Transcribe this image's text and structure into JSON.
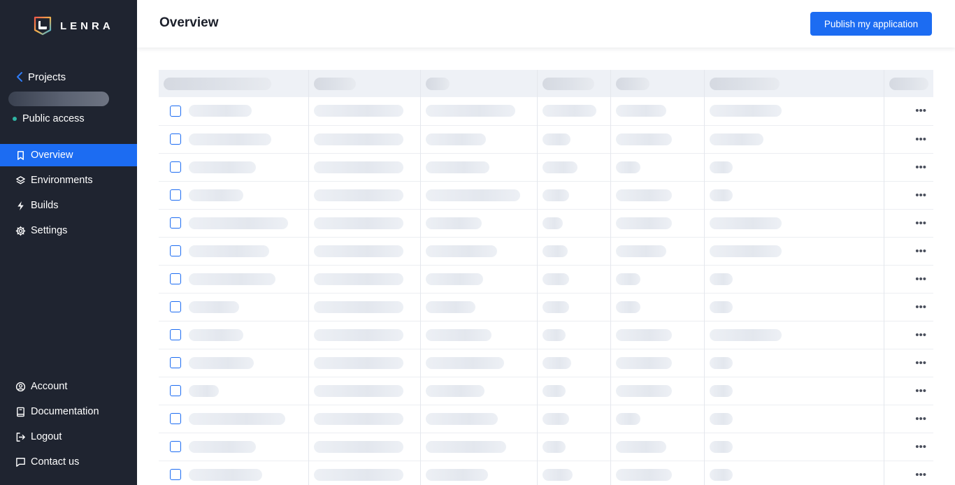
{
  "brand": {
    "name": "LENRA"
  },
  "sidebar": {
    "back_label": "Projects",
    "access_label": "Public access",
    "access_color": "#2fb4a3",
    "nav": [
      {
        "label": "Overview",
        "icon": "bookmark-icon",
        "active": true
      },
      {
        "label": "Environments",
        "icon": "layers-icon",
        "active": false
      },
      {
        "label": "Builds",
        "icon": "bolt-icon",
        "active": false
      },
      {
        "label": "Settings",
        "icon": "gear-icon",
        "active": false
      }
    ],
    "bottom": [
      {
        "label": "Account",
        "icon": "user-icon"
      },
      {
        "label": "Documentation",
        "icon": "book-icon"
      },
      {
        "label": "Logout",
        "icon": "logout-icon"
      },
      {
        "label": "Contact us",
        "icon": "chat-icon"
      }
    ]
  },
  "header": {
    "title": "Overview",
    "publish_label": "Publish my application"
  },
  "colors": {
    "accent": "#1c6cf2",
    "sidebar_bg": "#1f2430",
    "status_orange": "#f5b75c",
    "status_green": "#2fb4a3",
    "status_red": "#ec5b63"
  },
  "table": {
    "row_count": 14,
    "status_column": 5,
    "row_status": [
      "orange",
      "green",
      "red",
      "green",
      "green",
      "orange",
      "red",
      "red",
      "green",
      "green",
      "green",
      "red",
      "orange",
      "green"
    ],
    "row_menu_label": "•••"
  }
}
